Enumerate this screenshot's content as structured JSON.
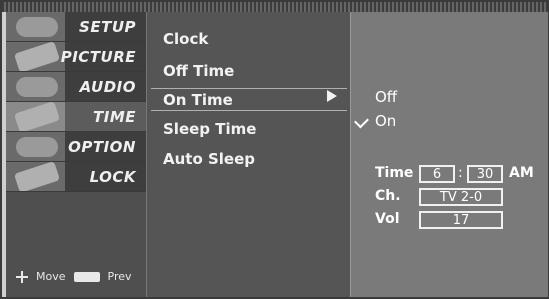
{
  "tabs": [
    {
      "label": "SETUP",
      "active": false,
      "icon": "setup-icon"
    },
    {
      "label": "PICTURE",
      "active": false,
      "icon": "picture-icon"
    },
    {
      "label": "AUDIO",
      "active": false,
      "icon": "audio-icon"
    },
    {
      "label": "TIME",
      "active": true,
      "icon": "time-icon"
    },
    {
      "label": "OPTION",
      "active": false,
      "icon": "option-icon"
    },
    {
      "label": "LOCK",
      "active": false,
      "icon": "lock-icon"
    }
  ],
  "footer": {
    "move_label": "Move",
    "menu_key_label": "MENU",
    "prev_label": "Prev",
    "move_icon": "dpad-icon"
  },
  "menu": {
    "items": [
      {
        "label": "Clock"
      },
      {
        "label": "Off Time"
      },
      {
        "label": "On Time",
        "selected": true
      },
      {
        "label": "Sleep Time"
      },
      {
        "label": "Auto Sleep"
      }
    ]
  },
  "on_time": {
    "options": [
      {
        "label": "Off",
        "checked": false
      },
      {
        "label": "On",
        "checked": true
      }
    ],
    "time_label": "Time",
    "hour": "6",
    "minute": "30",
    "ampm": "AM",
    "ch_label": "Ch.",
    "channel": "TV 2-0",
    "vol_label": "Vol",
    "volume": "17"
  }
}
